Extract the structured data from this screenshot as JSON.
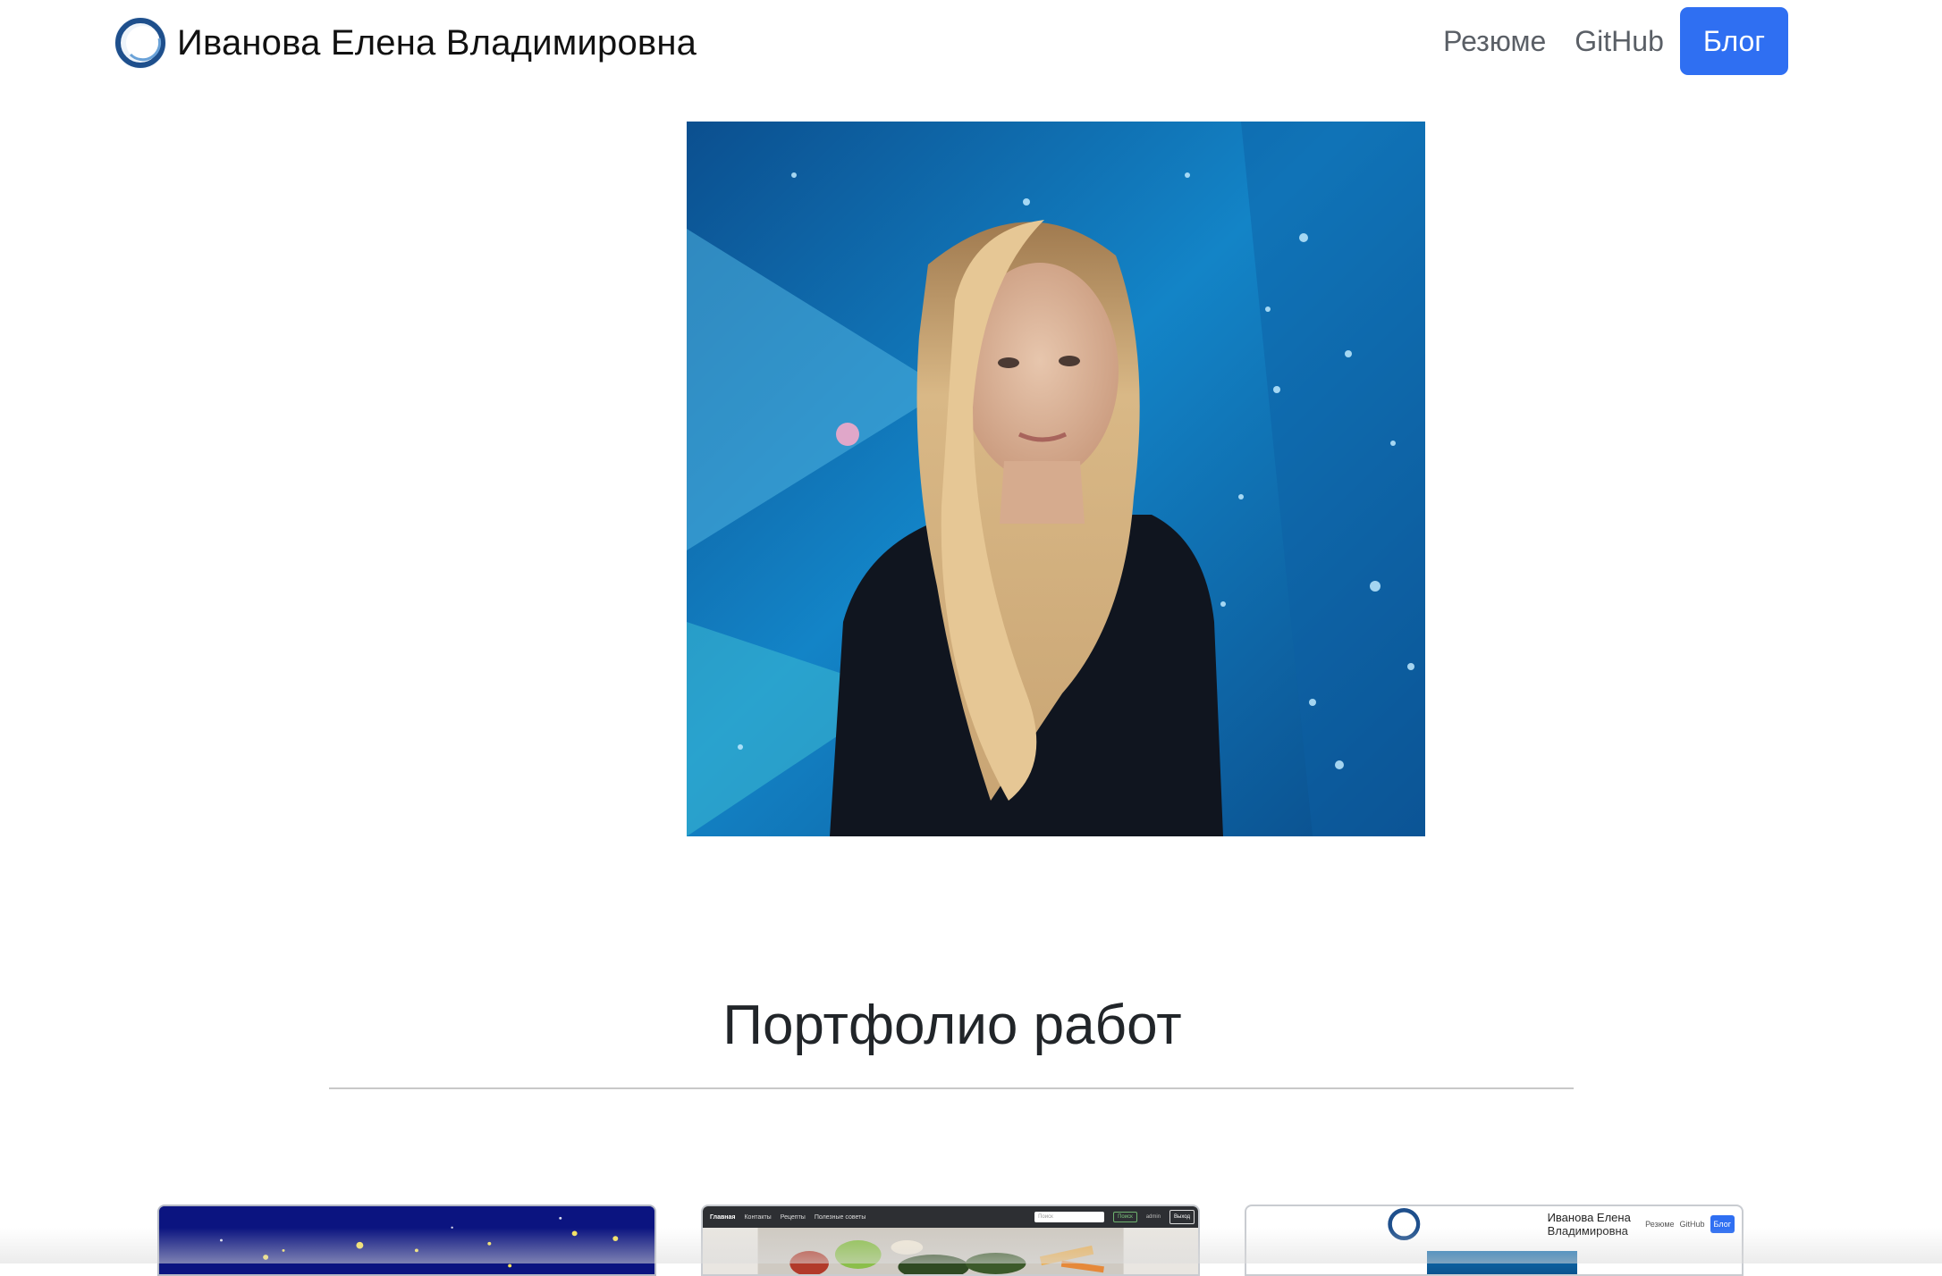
{
  "navbar": {
    "brand_name": "Иванова Елена Владимировна",
    "links": [
      {
        "label": "Резюме",
        "active": false
      },
      {
        "label": "GitHub",
        "active": false
      },
      {
        "label": "Блог",
        "active": true
      }
    ],
    "accent_color": "#2f6ff2"
  },
  "hero": {
    "photo": "portrait-photo"
  },
  "portfolio": {
    "title": "Портфолио работ",
    "cards": [
      {
        "preview": "starry-night-preview"
      },
      {
        "preview": "recipes-site-preview",
        "nav_items": [
          "Главная",
          "Контакты",
          "Рецепты",
          "Полезные советы"
        ],
        "search_placeholder": "Поиск",
        "search_button": "Поиск",
        "user": "admin",
        "exit_button": "Выход"
      },
      {
        "preview": "portfolio-site-preview",
        "brand": "Иванова Елена Владимировна",
        "links": [
          "Резюме",
          "GitHub",
          "Блог"
        ]
      }
    ]
  }
}
